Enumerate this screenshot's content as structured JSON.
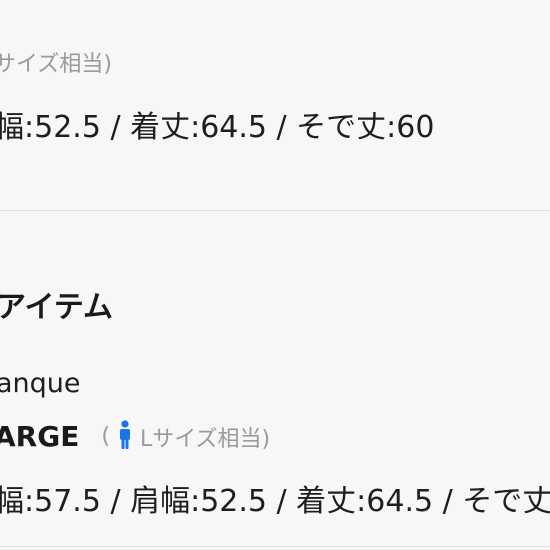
{
  "top_item": {
    "size_note": "サイズ相当)",
    "measurements": "幅:52.5 / 着丈:64.5 / そで丈:60"
  },
  "related_section": {
    "heading": "アイテム",
    "brand": "anque",
    "size_label": "ARGE",
    "size_note_open": "(",
    "size_note_text": "Lサイズ相当)",
    "person_icon": "person-icon",
    "icon_color": "#1a73e8",
    "measurements": "幅:57.5 / 肩幅:52.5 / 着丈:64.5 / そで丈"
  }
}
